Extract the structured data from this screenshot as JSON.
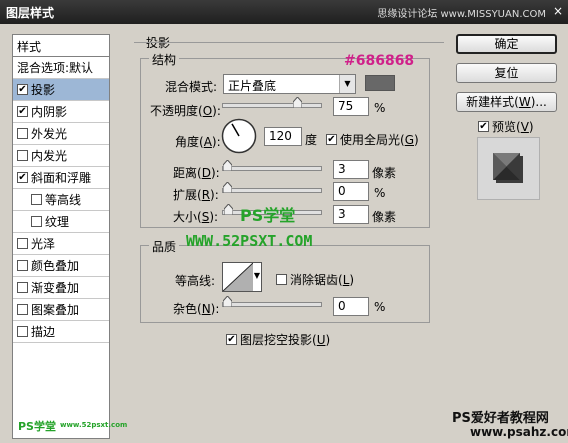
{
  "window": {
    "title": "图层样式",
    "watermark": "思缘设计论坛 www.MISSYUAN.COM",
    "close": "×"
  },
  "styles_list": {
    "header": "样式",
    "items": [
      {
        "label": "混合选项:默认",
        "checkbox": false,
        "selected": false,
        "sub": false
      },
      {
        "label": "投影",
        "checkbox": true,
        "checked": true,
        "selected": true,
        "sub": false
      },
      {
        "label": "内阴影",
        "checkbox": true,
        "checked": true,
        "selected": false,
        "sub": false
      },
      {
        "label": "外发光",
        "checkbox": true,
        "checked": false,
        "selected": false,
        "sub": false
      },
      {
        "label": "内发光",
        "checkbox": true,
        "checked": false,
        "selected": false,
        "sub": false
      },
      {
        "label": "斜面和浮雕",
        "checkbox": true,
        "checked": true,
        "selected": false,
        "sub": false
      },
      {
        "label": "等高线",
        "checkbox": true,
        "checked": false,
        "selected": false,
        "sub": true
      },
      {
        "label": "纹理",
        "checkbox": true,
        "checked": false,
        "selected": false,
        "sub": true
      },
      {
        "label": "光泽",
        "checkbox": true,
        "checked": false,
        "selected": false,
        "sub": false
      },
      {
        "label": "颜色叠加",
        "checkbox": true,
        "checked": false,
        "selected": false,
        "sub": false
      },
      {
        "label": "渐变叠加",
        "checkbox": true,
        "checked": false,
        "selected": false,
        "sub": false
      },
      {
        "label": "图案叠加",
        "checkbox": true,
        "checked": false,
        "selected": false,
        "sub": false
      },
      {
        "label": "描边",
        "checkbox": true,
        "checked": false,
        "selected": false,
        "sub": false
      }
    ]
  },
  "drop_shadow": {
    "section_title": "投影",
    "structure": {
      "legend": "结构",
      "color_annotation": "#686868",
      "swatch_color": "#686868",
      "blend_mode_label": "混合模式:",
      "blend_mode_value": "正片叠底",
      "opacity_label": "不透明度(",
      "opacity_key": "O",
      "opacity_value": "75",
      "opacity_fraction": 0.75,
      "percent": "%",
      "angle_label": "角度(",
      "angle_key": "A",
      "angle_value": "120",
      "angle_unit": "度",
      "global_light_label": "使用全局光(",
      "global_light_key": "G",
      "global_light_checked": true,
      "distance_label": "距离(",
      "distance_key": "D",
      "distance_value": "3",
      "spread_label": "扩展(",
      "spread_key": "R",
      "spread_value": "0",
      "size_label": "大小(",
      "size_key": "S",
      "size_value": "3",
      "unit_px": "像素",
      "paren_close": "):"
    },
    "quality": {
      "legend": "品质",
      "contour_label": "等高线:",
      "antialias_label": "消除锯齿(",
      "antialias_key": "L",
      "antialias_checked": false,
      "noise_label": "杂色(",
      "noise_key": "N",
      "noise_value": "0",
      "percent": "%"
    },
    "knockout_label": "图层挖空投影(",
    "knockout_key": "U",
    "knockout_checked": true,
    "paren_close": ")"
  },
  "buttons": {
    "ok": "确定",
    "reset": "复位",
    "new_style": "新建样式(",
    "new_style_key": "W",
    "new_style_tail": ")...",
    "preview": "预览(",
    "preview_key": "V",
    "preview_checked": true
  },
  "overlays": {
    "ps_school": "PS学堂",
    "site": "WWW.52PSXT.COM",
    "corner_brand": "PS学堂",
    "corner_url": "www.52psxt.com",
    "footer_title": "PS爱好者教程网",
    "footer_url": "www.psahz.com"
  },
  "colors": {
    "accent_annotation": "#d0208a",
    "overlay_green": "#25a32a",
    "selection": "#9db7d6"
  }
}
